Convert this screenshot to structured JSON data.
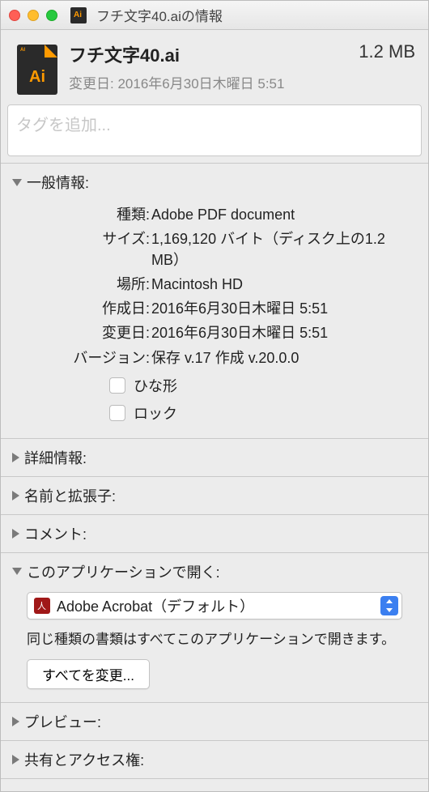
{
  "titlebar": {
    "title": "フチ文字40.aiの情報"
  },
  "header": {
    "filename": "フチ文字40.ai",
    "filesize": "1.2 MB",
    "modified_label": "変更日:",
    "modified_value": "2016年6月30日木曜日 5:51"
  },
  "tags": {
    "placeholder": "タグを追加..."
  },
  "sections": {
    "general": {
      "title": "一般情報:",
      "kind_label": "種類:",
      "kind_value": "Adobe PDF document",
      "size_label": "サイズ:",
      "size_value": "1,169,120 バイト（ディスク上の1.2 MB）",
      "where_label": "場所:",
      "where_value": "Macintosh HD",
      "created_label": "作成日:",
      "created_value": "2016年6月30日木曜日 5:51",
      "modified_label": "変更日:",
      "modified_value": "2016年6月30日木曜日 5:51",
      "version_label": "バージョン:",
      "version_value": "保存  v.17 作成  v.20.0.0",
      "stationery": "ひな形",
      "locked": "ロック"
    },
    "more_info": "詳細情報:",
    "name_ext": "名前と拡張子:",
    "comments": "コメント:",
    "open_with": {
      "title": "このアプリケーションで開く:",
      "app": "Adobe Acrobat（デフォルト）",
      "desc": "同じ種類の書類はすべてこのアプリケーションで開きます。",
      "button": "すべてを変更..."
    },
    "preview": "プレビュー:",
    "sharing": "共有とアクセス権:"
  }
}
